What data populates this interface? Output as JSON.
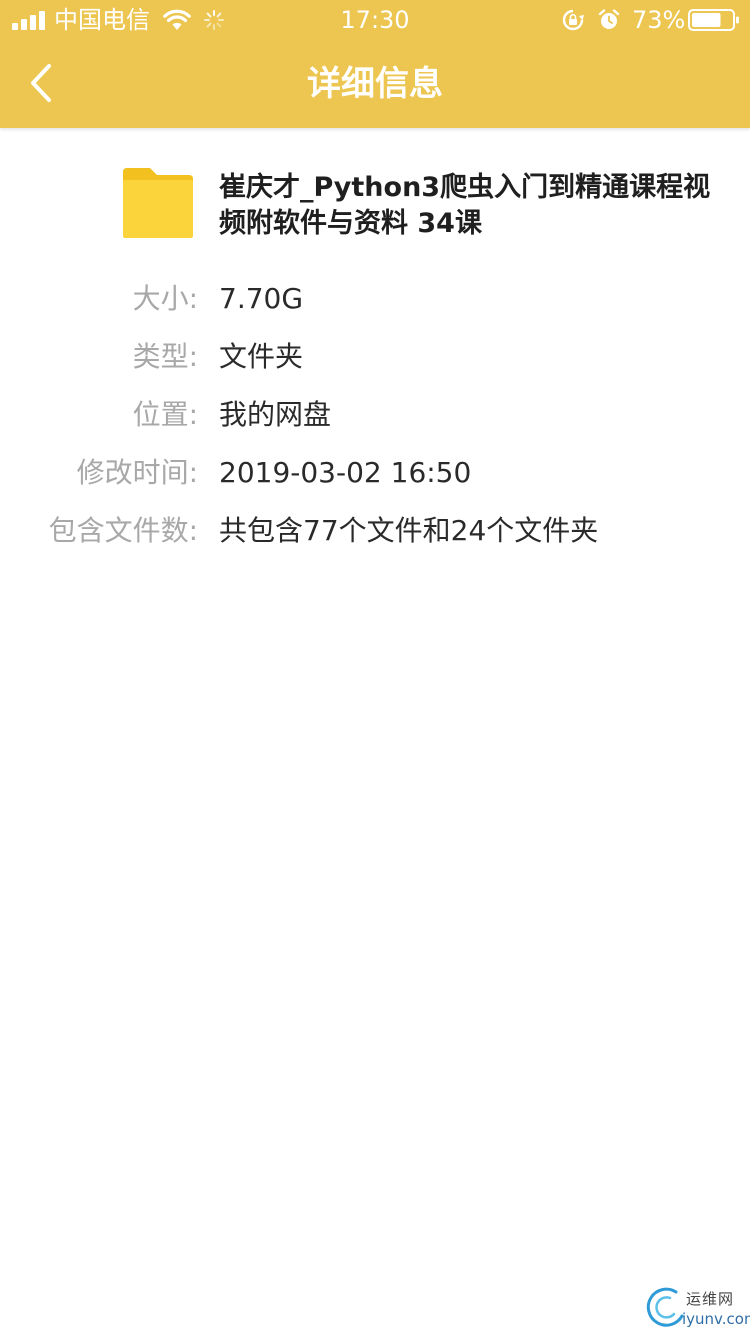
{
  "status_bar": {
    "carrier": "中国电信",
    "time": "17:30",
    "battery_percent": "73%",
    "battery_level": 0.73,
    "icons": [
      "signal-icon",
      "wifi-icon",
      "activity-spinner-icon",
      "orientation-lock-icon",
      "alarm-icon",
      "battery-icon"
    ]
  },
  "nav": {
    "title": "详细信息",
    "back_icon": "chevron-left-icon"
  },
  "file": {
    "icon": "folder-icon",
    "name": "崔庆才_Python3爬虫入门到精通课程视频附软件与资料 34课"
  },
  "details": [
    {
      "label": "大小:",
      "value": "7.70G"
    },
    {
      "label": "类型:",
      "value": "文件夹"
    },
    {
      "label": "位置:",
      "value": "我的网盘"
    },
    {
      "label": "修改时间:",
      "value": "2019-03-02 16:50"
    },
    {
      "label": "包含文件数:",
      "value": "共包含77个文件和24个文件夹"
    }
  ],
  "watermark": {
    "cn": "运维网",
    "en": "iyunv.com"
  },
  "colors": {
    "header": "#ecc650",
    "folder": "#fbd33a",
    "folder_tab": "#f2c01f",
    "label": "#a8a8a8",
    "value": "#2a2a2a"
  }
}
